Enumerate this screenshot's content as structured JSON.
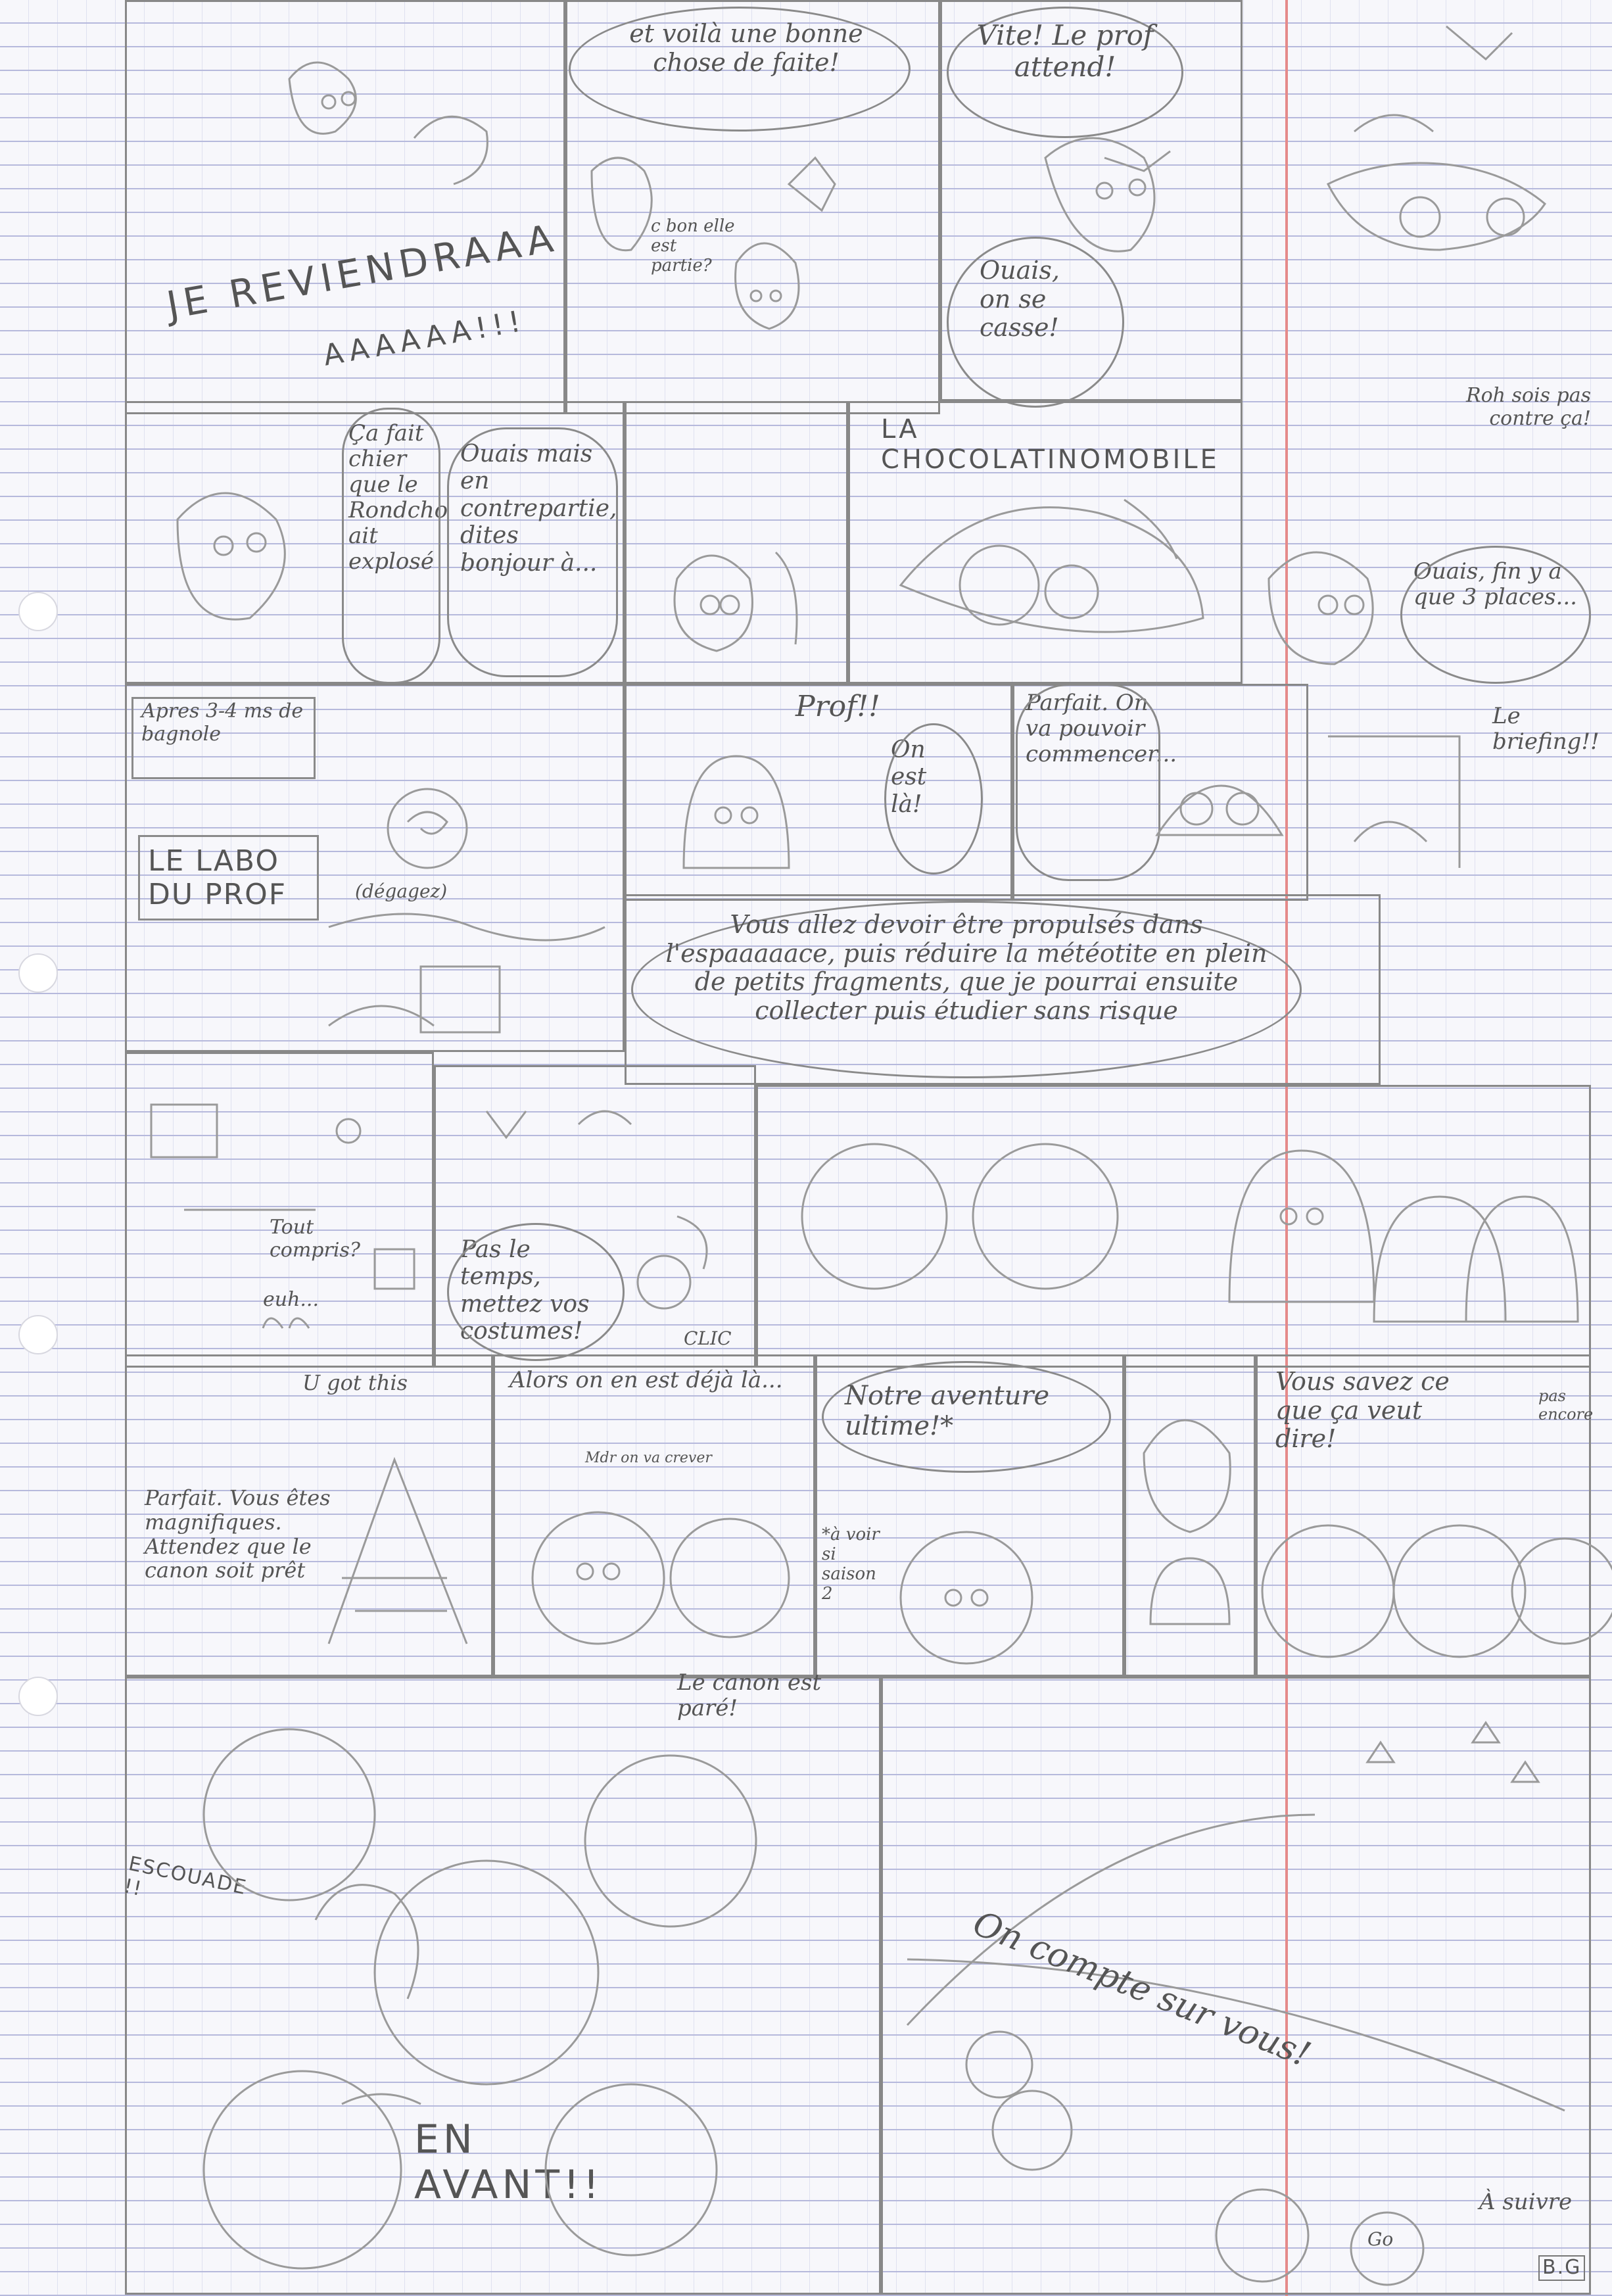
{
  "texts": {
    "p1_scream": "JE REVIENDRAAA",
    "p1_scream2": "AAAAAA!!!",
    "p2_bubble": "et voilà une bonne chose de faite!",
    "p2_side": "c bon elle est partie?",
    "p3_bubble": "Vite! Le prof attend!",
    "p3_ouais": "Ouais, on se casse!",
    "p4_bubble": "Ça fait chier que le Rondcho ait explosé",
    "p4_reply": "Ouais mais en contrepartie, dites bonjour à...",
    "p5_title": "LA CHOCOLATINOMOBILE",
    "p6_top": "Roh sois pas contre ça!",
    "p6_mid": "Ouais, fin y a que 3 places...",
    "p6_brief": "Le briefing!!",
    "p7_caption": "Apres 3-4 ms de bagnole",
    "p7_labo": "LE LABO DU PROF",
    "p7_degagez": "(dégagez)",
    "p8_prof": "Prof!!",
    "p8_onest": "On est là!",
    "p9_parfait": "Parfait. On va pouvoir commencer...",
    "p10_speech": "Vous allez devoir être propulsés dans l'espaaaaace, puis réduire la météotite en plein de petits fragments, que je pourrai ensuite collecter puis étudier sans risque",
    "p11_tout": "Tout compris?",
    "p11_euh": "euh...",
    "p12_paslt": "Pas le temps, mettez vos costumes!",
    "p12_clic": "CLIC",
    "p14_ugot": "U got this",
    "p14_parfait": "Parfait. Vous êtes magnifiques. Attendez que le canon soit prêt",
    "p15_alors": "Alors on en est déjà là...",
    "p15_mdr": "Mdr on va crever",
    "p16_notre": "Notre aventure ultime!*",
    "p16_note": "*à voir si saison 2",
    "p18_vous": "Vous savez ce que ça veut dire!",
    "p18_pas": "pas encore",
    "p19_canon": "Le canon est paré!",
    "p19_escouade": "ESCOUADE !!",
    "p19_enavant": "EN AVANT!!",
    "p20_compte": "On compte sur vous!",
    "p20_asuivre": "À suivre",
    "p20_go": "Go",
    "p20_sig": "B.G"
  }
}
